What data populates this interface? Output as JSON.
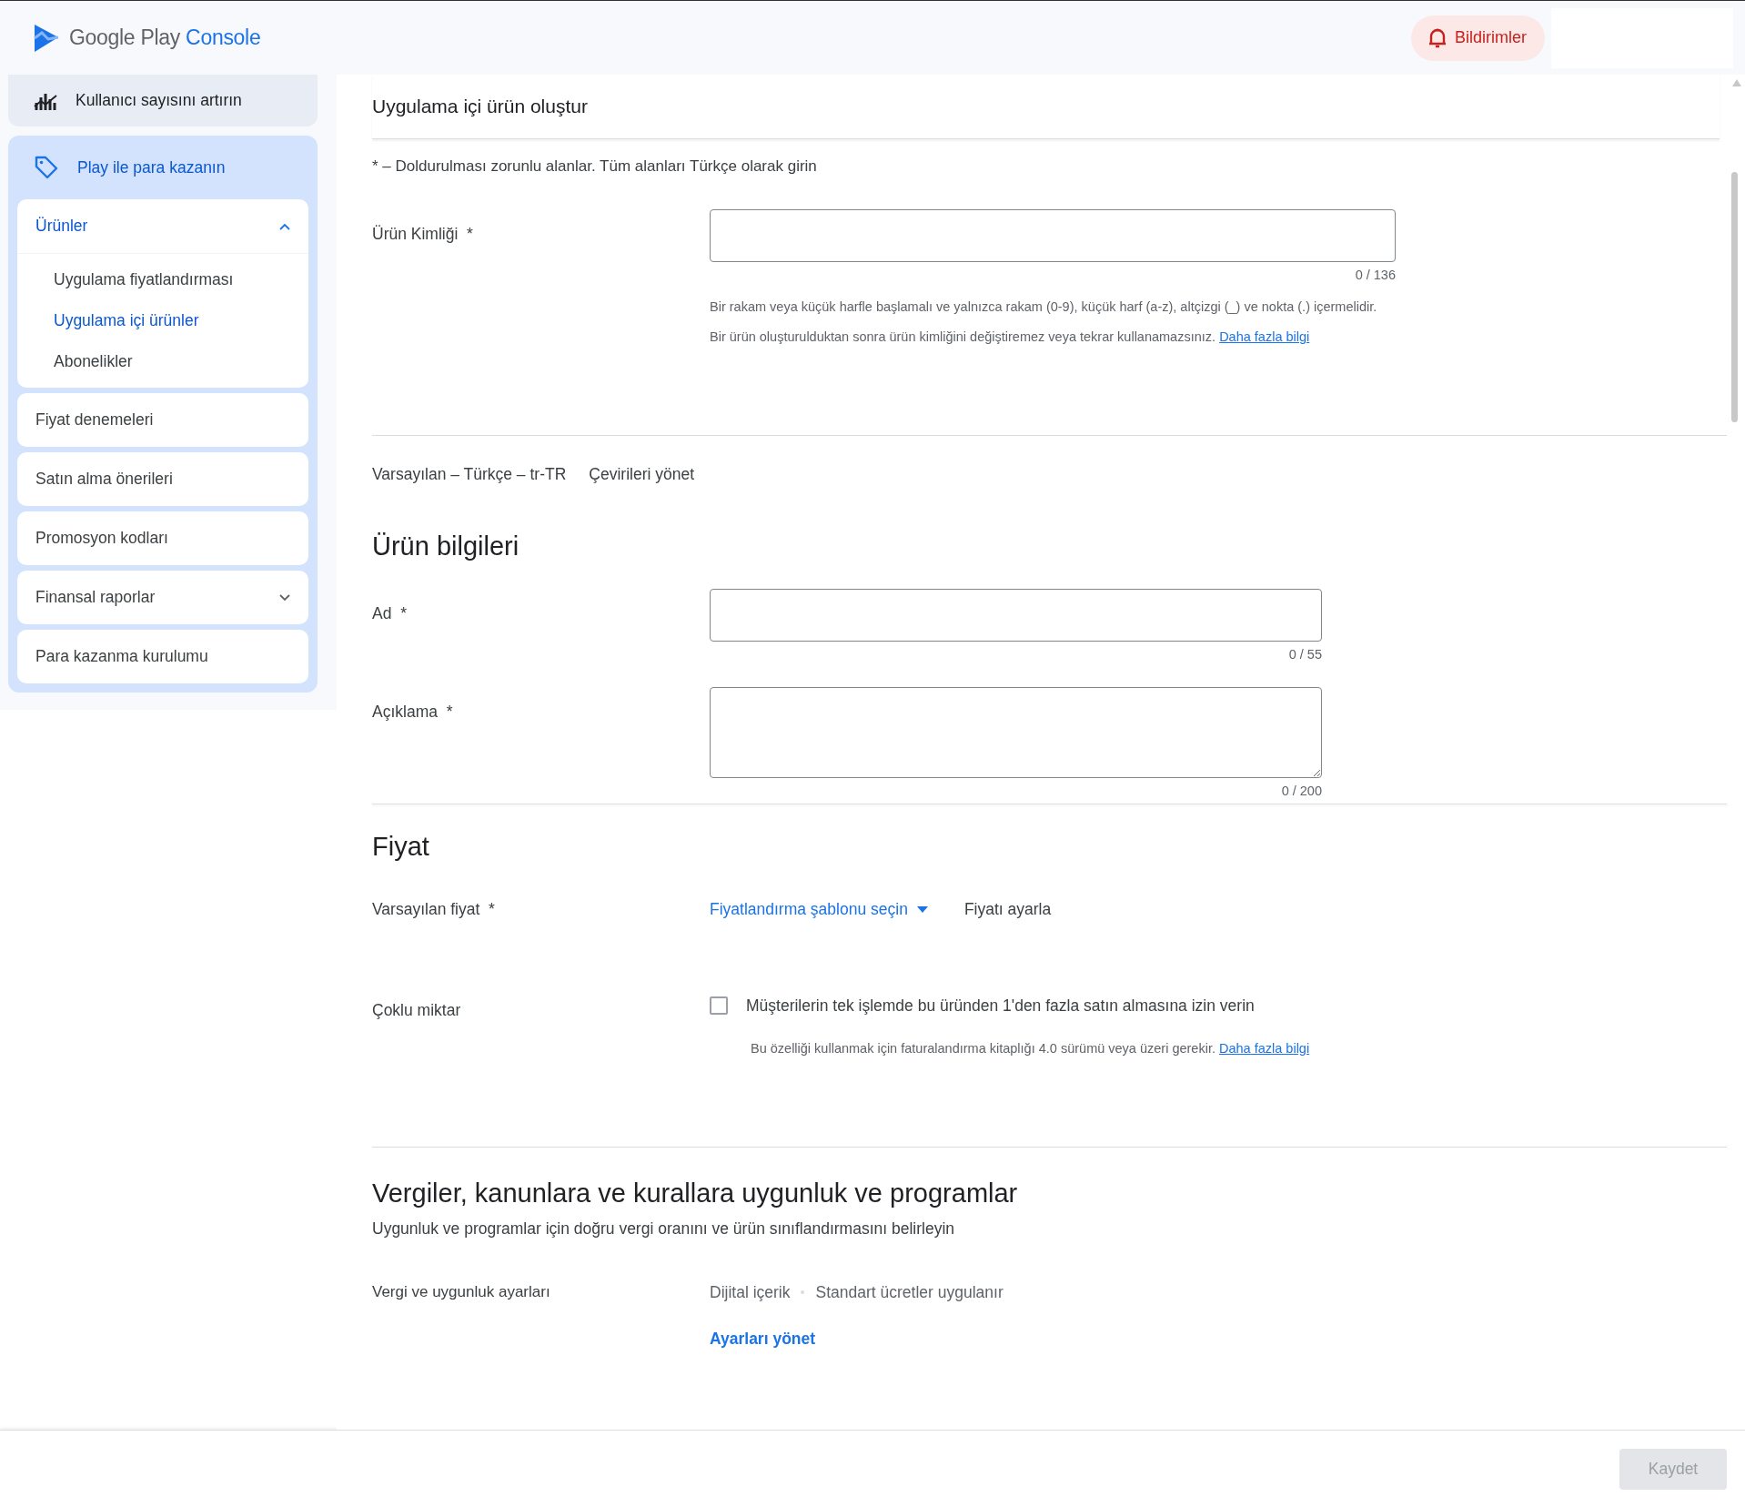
{
  "header": {
    "logo": {
      "brand": "Google Play",
      "product": "Console"
    },
    "notifications": {
      "label": "Bildirimler"
    }
  },
  "sidebar": {
    "sections": [
      {
        "label": "Kullanıcı sayısını artırın",
        "selected": false
      },
      {
        "label": "Play ile para kazanın",
        "selected": true,
        "groups": [
          {
            "label": "Ürünler",
            "expanded": true,
            "children": [
              {
                "label": "Uygulama fiyatlandırması",
                "selected": false
              },
              {
                "label": "Uygulama içi ürünler",
                "selected": true
              },
              {
                "label": "Abonelikler",
                "selected": false
              }
            ]
          },
          {
            "label": "Fiyat denemeleri"
          },
          {
            "label": "Satın alma önerileri"
          },
          {
            "label": "Promosyon kodları"
          },
          {
            "label": "Finansal raporlar",
            "expanded": false
          },
          {
            "label": "Para kazanma kurulumu"
          }
        ]
      }
    ]
  },
  "page": {
    "title": "Uygulama içi ürün oluştur",
    "required_note": "* – Doldurulması zorunlu alanlar. Tüm alanları Türkçe olarak girin",
    "product_id": {
      "label": "Ürün Kimliği",
      "marker": "*",
      "counter": "0 / 136",
      "help": "Bir rakam veya küçük harfle başlamalı ve yalnızca rakam (0-9), küçük harf (a-z), altçizgi (_) ve nokta (.) içermelidir.",
      "note": "Bir ürün oluşturulduktan sonra ürün kimliğini değiştiremez veya tekrar kullanamazsınız.",
      "link": "Daha fazla bilgi"
    },
    "language": {
      "default": "Varsayılan – Türkçe – tr-TR",
      "manage": "Çevirileri yönet"
    },
    "product_info": {
      "heading": "Ürün bilgileri",
      "fields": [
        {
          "label": "Ad",
          "marker": "*",
          "counter": "0 / 55",
          "kind": "input"
        },
        {
          "label": "Açıklama",
          "marker": "*",
          "counter": "0 / 200",
          "kind": "textarea"
        }
      ]
    },
    "price": {
      "heading": "Fiyat",
      "default_price": {
        "label": "Varsayılan fiyat",
        "marker": "*",
        "template": "Fiyatlandırma şablonu seçin",
        "set_price": "Fiyatı ayarla"
      },
      "multi_quantity": {
        "label": "Çoklu miktar",
        "checkbox": "Müşterilerin tek işlemde bu üründen 1'den fazla satın almasına izin verin",
        "checked": false,
        "note": "Bu özelliği kullanmak için faturalandırma kitaplığı 4.0 sürümü veya üzeri gerekir.",
        "link": "Daha fazla bilgi"
      }
    },
    "tax": {
      "heading": "Vergiler, kanunlara ve kurallara uygunluk ve programlar",
      "subtitle": "Uygunluk ve programlar için doğru vergi oranını ve ürün sınıflandırmasını belirleyin",
      "label": "Vergi ve uygunluk ayarları",
      "values": [
        "Dijital içerik",
        "Standart ücretler uygulanır"
      ],
      "link": "Ayarları yönet"
    }
  },
  "footer": {
    "save": {
      "label": "Kaydet",
      "disabled": true
    }
  }
}
